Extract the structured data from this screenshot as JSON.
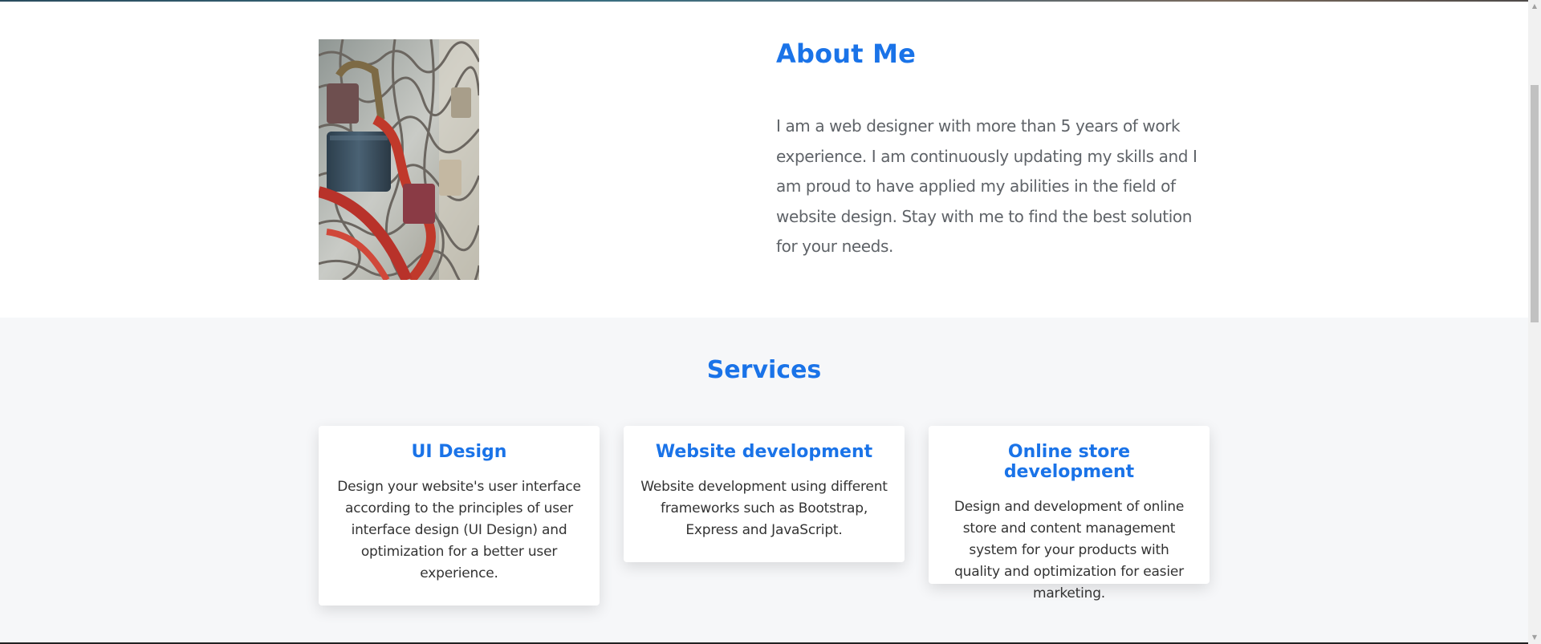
{
  "about": {
    "title": "About Me",
    "text": "I am a web designer with more than 5 years of work experience. I am continuously updating my skills and I am proud to have applied my abilities in the field of website design. Stay with me to find the best solution for your needs.",
    "image": "locks-on-fence-photo"
  },
  "services": {
    "title": "Services",
    "cards": [
      {
        "title": "UI Design",
        "text": "Design your website's user interface according to the principles of user interface design (UI Design) and optimization for a better user experience."
      },
      {
        "title": "Website development",
        "text": "Website development using different frameworks such as Bootstrap, Express and JavaScript."
      },
      {
        "title": "Online store development",
        "text": "Design and development of online store and content management system for your products with quality and optimization for easier marketing."
      }
    ]
  },
  "colors": {
    "accent": "#1a73e8",
    "services_bg": "#f6f7f9",
    "body_text": "#5f6368"
  }
}
